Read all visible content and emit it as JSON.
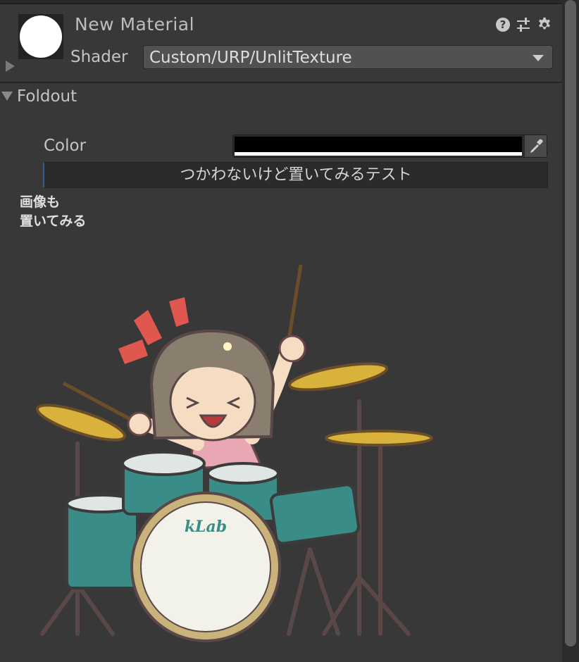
{
  "header": {
    "material_name": "New Material",
    "shader_label": "Shader",
    "shader_value": "Custom/URP/UnlitTexture",
    "icons": [
      "help-icon",
      "preset-sliders-icon",
      "gear-icon"
    ]
  },
  "foldout": {
    "label": "Foldout",
    "expanded": true,
    "color_label": "Color",
    "color_value": "#000000",
    "color_alpha": "#ffffff",
    "button_label": "つかわないけど置いてみるテスト",
    "image_label_line1": "画像も",
    "image_label_line2": "置いてみる",
    "image_logo_text": "kLab"
  },
  "colors": {
    "panel_bg": "#383838",
    "field_bg": "#515151",
    "drum_teal": "#3a8d86",
    "cymbal_gold": "#d8b23a",
    "accent_red": "#e0574f"
  }
}
